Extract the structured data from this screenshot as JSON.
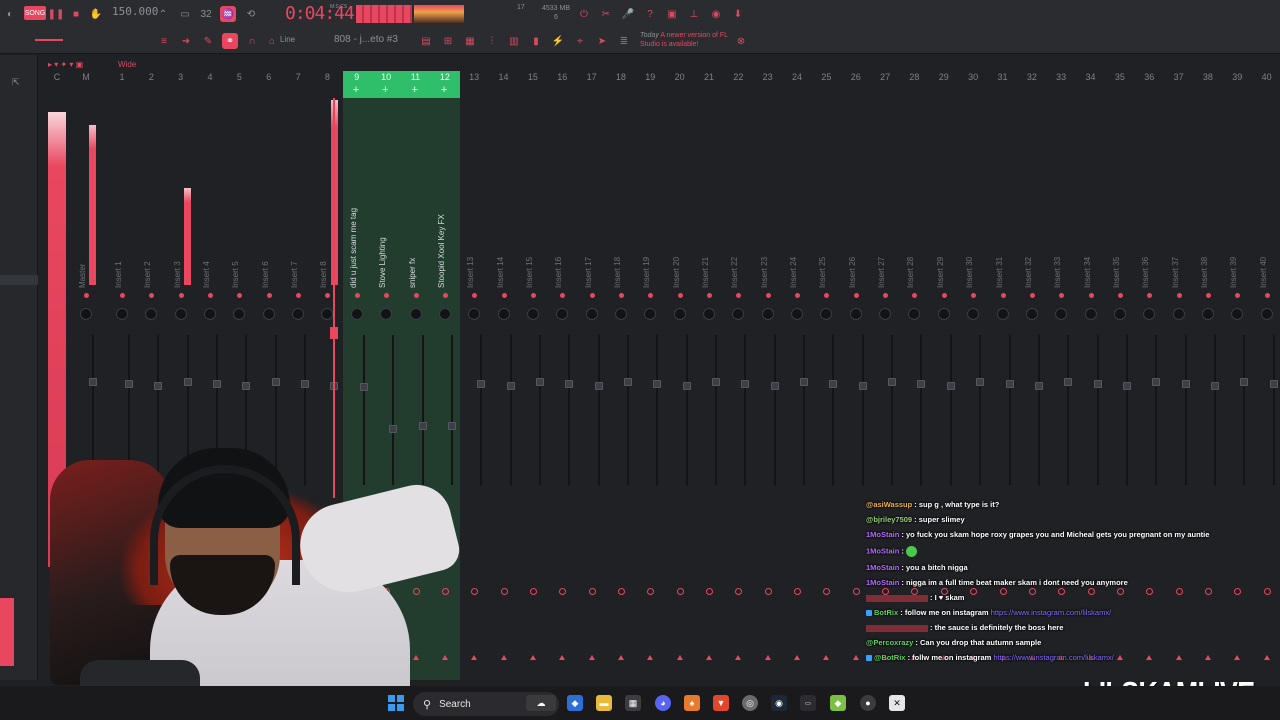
{
  "toolbar": {
    "song_label": "SONG",
    "tempo": "150.000",
    "time": "0:04:44",
    "time_unit": "M:S:CS",
    "cpu_value": "17",
    "memory_value": "4533 MB",
    "memory_sub": "6",
    "pattern_name": "808 - j...eto #3",
    "snap_label": "Line",
    "news_date": "Today",
    "news_text": "A newer version of FL Studio is available!"
  },
  "mixer": {
    "mode_label": "Wide",
    "track_numbers": [
      "C",
      "M",
      "1",
      "2",
      "3",
      "4",
      "5",
      "6",
      "7",
      "8",
      "9",
      "10",
      "11",
      "12",
      "13",
      "14",
      "15",
      "16",
      "17",
      "18",
      "19",
      "20",
      "21",
      "22",
      "23",
      "24",
      "25",
      "26",
      "27",
      "28",
      "29",
      "30",
      "31",
      "32",
      "33",
      "34",
      "35",
      "36",
      "37",
      "38",
      "39",
      "40"
    ],
    "insert_labels": [
      "Master",
      "Insert 1",
      "Insert 2",
      "Insert 3",
      "Insert 4",
      "Insert 5",
      "Insert 6",
      "Insert 7",
      "Insert 8",
      "did u just scam me tag",
      "Stove Lighting",
      "sniper fx",
      "Stoopid Xool Key FX",
      "Insert 13",
      "Insert 14",
      "Insert 15",
      "Insert 16",
      "Insert 17",
      "Insert 18",
      "Insert 19",
      "Insert 20",
      "Insert 21",
      "Insert 22",
      "Insert 23",
      "Insert 24",
      "Insert 25",
      "Insert 26",
      "Insert 27",
      "Insert 28",
      "Insert 29",
      "Insert 30",
      "Insert 31",
      "Insert 32",
      "Insert 33",
      "Insert 34",
      "Insert 35",
      "Insert 36",
      "Insert 37",
      "Insert 38",
      "Insert 39",
      "Insert 40"
    ],
    "selected_tracks": [
      "9",
      "10",
      "11",
      "12"
    ]
  },
  "chat": [
    {
      "user": "@asiWassup",
      "sep": " : ",
      "msg": "sup g , what type is it?",
      "color": "#f0b44c"
    },
    {
      "user": "@bjriley7509",
      "sep": " : ",
      "msg": "super slimey",
      "color": "#9ad17a"
    },
    {
      "user": "1MoStain",
      "sep": " : ",
      "msg": "yo fuck you skam hope roxy grapes you and Micheal gets you pregnant on my auntie",
      "color": "#b46cff"
    },
    {
      "user": "1MoStain",
      "sep": " : ",
      "msg": "",
      "color": "#b46cff",
      "emote": true
    },
    {
      "user": "1MoStain",
      "sep": " : ",
      "msg": "you a bitch nigga",
      "color": "#b46cff"
    },
    {
      "user": "1MoStain",
      "sep": " : ",
      "msg": "nigga im a full time beat maker skam i dont need you anymore",
      "color": "#b46cff"
    },
    {
      "user": "",
      "sep": "",
      "msg": ": I ♥ skam",
      "color": "#e8475f"
    },
    {
      "user": "BotRix",
      "sep": " : ",
      "msg": "follow me on instagram",
      "link": "https://www.instagram.com/lilskamx/",
      "color": "#5fd35f"
    },
    {
      "user": "",
      "sep": "",
      "msg": ": the sauce is definitely the boss here",
      "color": "#e8475f"
    },
    {
      "user": "@Percoxrazy",
      "sep": " : ",
      "msg": "Can you drop that autumn sample",
      "color": "#5fd35f"
    },
    {
      "user": "@BotRix",
      "sep": " : ",
      "msg": "follw me on instagram",
      "link": "https://www.instagram.com/lilskamx/",
      "color": "#5fd35f"
    }
  ],
  "watermark": "LILSKAMLIVE",
  "taskbar": {
    "search_label": "Search"
  },
  "colors": {
    "accent": "#e8475f",
    "selection": "#2fbf6a",
    "background": "#1e2024"
  }
}
